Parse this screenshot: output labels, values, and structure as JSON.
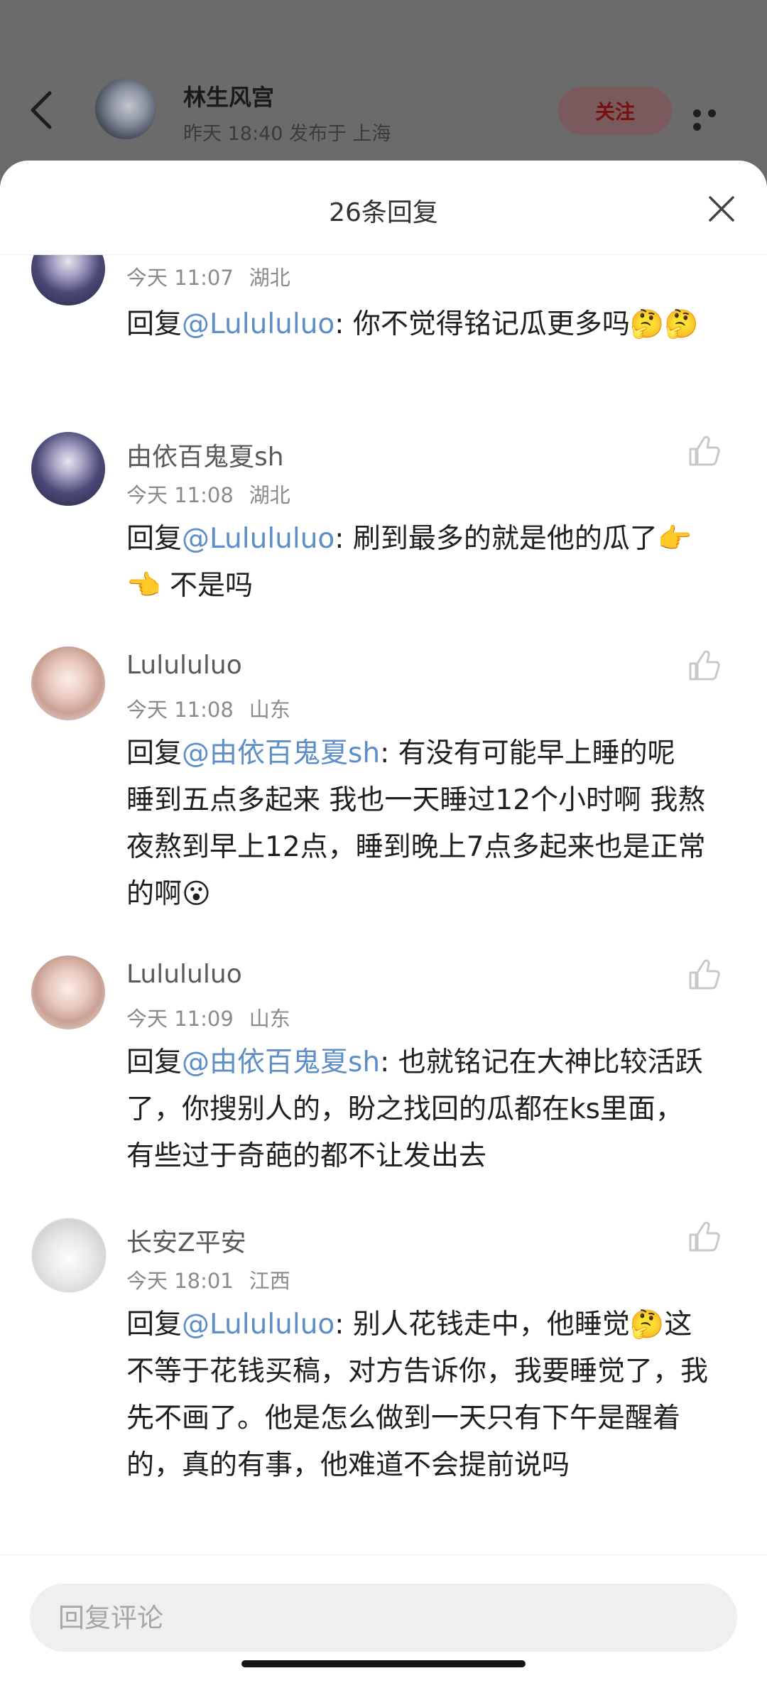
{
  "header": {
    "author_name": "林生风宫",
    "post_meta": "昨天 18:40 发布于 上海",
    "follow_label": "关注"
  },
  "sheet": {
    "title": "26条回复",
    "input_placeholder": "回复评论"
  },
  "comments": [
    {
      "name": "",
      "time": "今天 11:07",
      "location": "湖北",
      "prefix": "回复",
      "mention": "@Lulululuo",
      "text": ": 你不觉得铭记瓜更多吗🤔🤔"
    },
    {
      "name": "由依百鬼夏sh",
      "time": "今天 11:08",
      "location": "湖北",
      "prefix": "回复",
      "mention": "@Lulululuo",
      "text": ": 刷到最多的就是他的瓜了👉👈 不是吗"
    },
    {
      "name": "Lulululuo",
      "time": "今天 11:08",
      "location": "山东",
      "prefix": "回复",
      "mention": "@由依百鬼夏sh",
      "text": ": 有没有可能早上睡的呢 睡到五点多起来 我也一天睡过12个小时啊 我熬夜熬到早上12点，睡到晚上7点多起来也是正常的啊😮"
    },
    {
      "name": "Lulululuo",
      "time": "今天 11:09",
      "location": "山东",
      "prefix": "回复",
      "mention": "@由依百鬼夏sh",
      "text": ": 也就铭记在大神比较活跃了，你搜别人的，盼之找回的瓜都在ks里面，有些过于奇葩的都不让发出去"
    },
    {
      "name": "长安Z平安",
      "time": "今天 18:01",
      "location": "江西",
      "prefix": "回复",
      "mention": "@Lulululuo",
      "text": ": 别人花钱走中，他睡觉🤔这不等于花钱买稿，对方告诉你，我要睡觉了，我先不画了。他是怎么做到一天只有下午是醒着的，真的有事，他难道不会提前说吗"
    }
  ],
  "icons": {
    "back": "chevron-left-icon",
    "more": "more-horizontal-icon",
    "close": "close-icon",
    "like": "thumbs-up-icon"
  },
  "colors": {
    "mention": "#5d8ec7",
    "follow_text": "#7a1010"
  }
}
